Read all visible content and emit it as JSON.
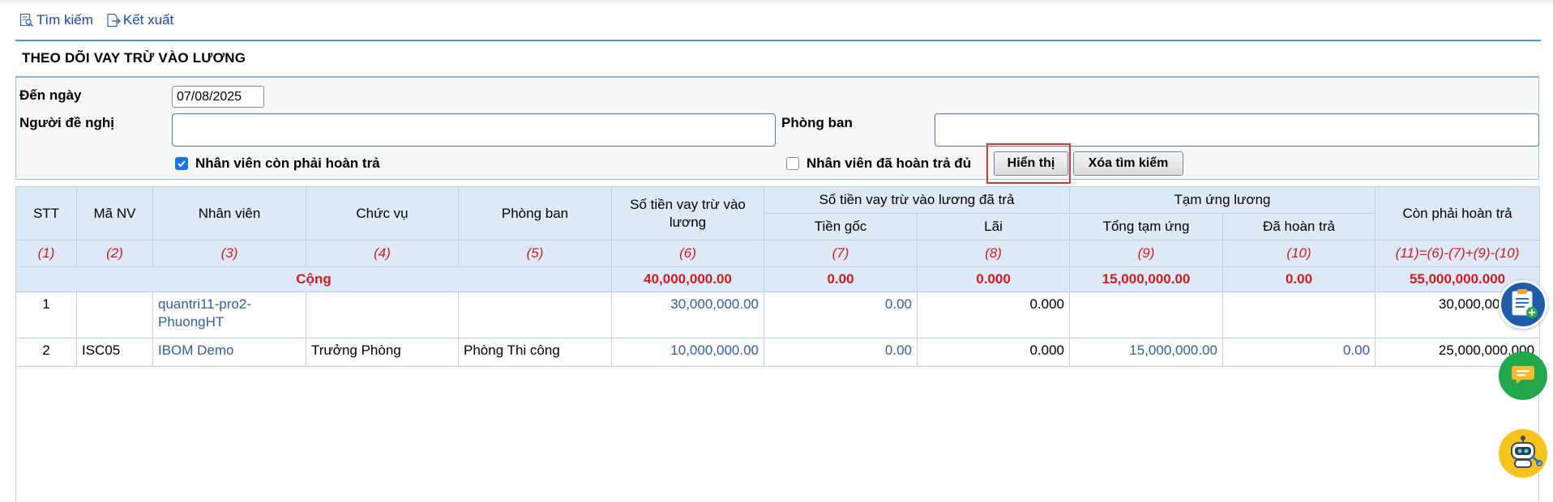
{
  "toolbar": {
    "search_label": "Tìm kiếm",
    "export_label": "Kết xuất"
  },
  "page": {
    "title": "THEO DÕI VAY TRỪ VÀO LƯƠNG"
  },
  "filters": {
    "to_date_label": "Đến ngày",
    "to_date_value": "07/08/2025",
    "proposer_label": "Người đề nghị",
    "proposer_value": "",
    "department_label": "Phòng ban",
    "department_value": "",
    "still_owing_label": "Nhân viên còn phải hoàn trả",
    "still_owing_checked": true,
    "fully_repaid_label": "Nhân viên đã hoàn trả đủ",
    "fully_repaid_checked": false,
    "show_button": "Hiển thị",
    "clear_button": "Xóa tìm kiếm"
  },
  "table": {
    "headers": {
      "stt": "STT",
      "employee_code": "Mã NV",
      "employee": "Nhân viên",
      "position": "Chức vụ",
      "department": "Phòng ban",
      "loan_amount": "Số tiền vay trừ vào lương",
      "paid_group": "Số tiền vay trừ vào lương đã trả",
      "principal": "Tiền gốc",
      "interest": "Lãi",
      "advance_group": "Tạm ứng lương",
      "total_advance": "Tổng tạm ứng",
      "repaid": "Đã hoàn trả",
      "remaining": "Còn phải hoàn trả"
    },
    "index_row": [
      "(1)",
      "(2)",
      "(3)",
      "(4)",
      "(5)",
      "(6)",
      "(7)",
      "(8)",
      "(9)",
      "(10)",
      "(11)=(6)-(7)+(9)-(10)"
    ],
    "total": {
      "label": "Cộng",
      "loan_amount": "40,000,000.00",
      "principal": "0.00",
      "interest": "0.000",
      "total_advance": "15,000,000.00",
      "repaid": "0.00",
      "remaining": "55,000,000.000"
    },
    "rows": [
      {
        "stt": "1",
        "employee_code": "",
        "employee": "quantri11-pro2-PhuongHT",
        "position": "",
        "department": "",
        "loan_amount": "30,000,000.00",
        "principal": "0.00",
        "interest": "0.000",
        "total_advance": "",
        "repaid": "",
        "remaining": "30,000,000.000"
      },
      {
        "stt": "2",
        "employee_code": "ISC05",
        "employee": "IBOM Demo",
        "position": "Trưởng Phòng",
        "department": "Phòng Thi công",
        "loan_amount": "10,000,000.00",
        "principal": "0.00",
        "interest": "0.000",
        "total_advance": "15,000,000.00",
        "repaid": "0.00",
        "remaining": "25,000,000.000"
      }
    ]
  },
  "floating": {
    "add_task_icon": "clipboard-plus-icon",
    "chat_icon": "chat-bubble-icon",
    "bot_icon": "robot-assistant-icon"
  }
}
